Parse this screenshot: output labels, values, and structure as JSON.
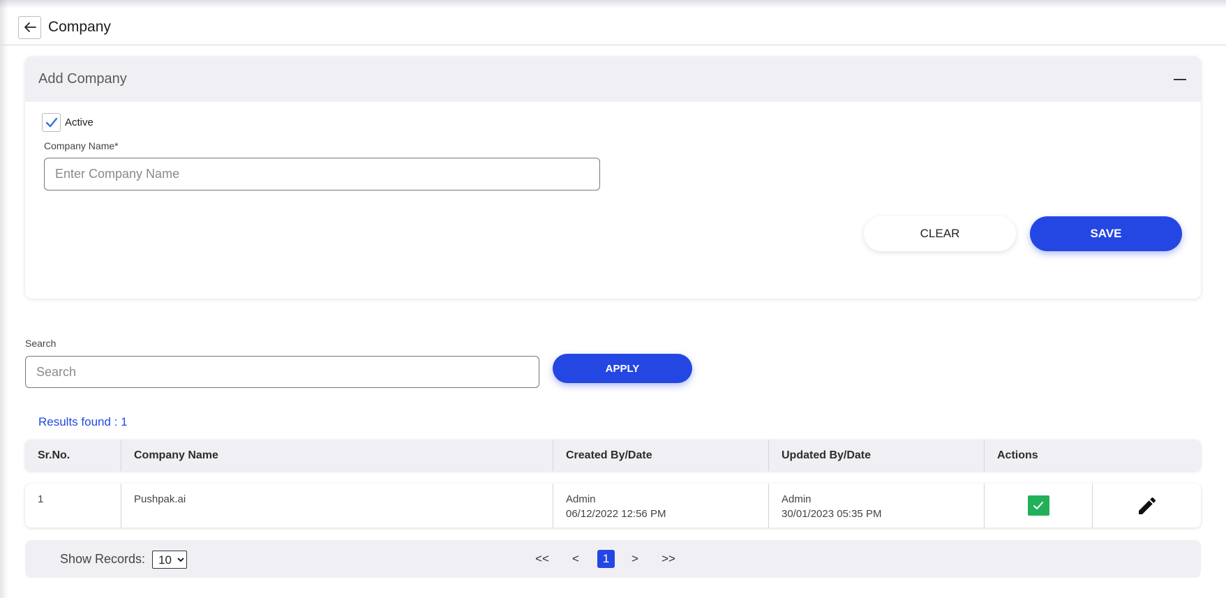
{
  "header": {
    "title": "Company",
    "back_icon": "arrow-left-icon"
  },
  "add_company": {
    "title": "Add Company",
    "collapse_icon": "minus-icon",
    "active_label": "Active",
    "active_checked": true,
    "company_name_label": "Company Name*",
    "company_name_placeholder": "Enter Company Name",
    "company_name_value": "",
    "clear_label": "CLEAR",
    "save_label": "SAVE"
  },
  "search": {
    "label": "Search",
    "placeholder": "Search",
    "value": "",
    "apply_label": "APPLY"
  },
  "results_text": "Results found : 1",
  "table": {
    "columns": [
      "Sr.No.",
      "Company Name",
      "Created By/Date",
      "Updated By/Date",
      "Actions"
    ],
    "rows": [
      {
        "sr_no": "1",
        "company_name": "Pushpak.ai",
        "created_by": "Admin",
        "created_date": "06/12/2022 12:56 PM",
        "updated_by": "Admin",
        "updated_date": "30/01/2023 05:35 PM",
        "status_active": true,
        "status_icon": "checkmark-icon",
        "edit_icon": "pencil-icon"
      }
    ]
  },
  "footer": {
    "show_records_label": "Show Records:",
    "records_per_page": "10",
    "pager": {
      "first": "<<",
      "prev": "<",
      "current": "1",
      "next": ">",
      "last": ">>"
    }
  },
  "colors": {
    "primary": "#2447e3",
    "success": "#22b05b",
    "panel": "#f0f0f4"
  }
}
